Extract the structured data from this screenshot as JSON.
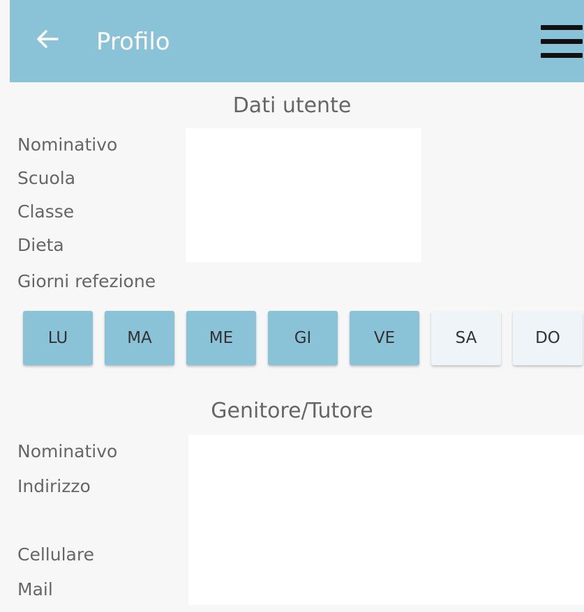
{
  "header": {
    "title": "Profilo",
    "back_icon": "arrow-left-icon",
    "menu_icon": "hamburger-menu-icon",
    "background": "#8ac3d8"
  },
  "user_data": {
    "section_title": "Dati utente",
    "labels": {
      "nominativo": "Nominativo",
      "scuola": "Scuola",
      "classe": "Classe",
      "dieta": "Dieta",
      "giorni": "Giorni refezione"
    }
  },
  "days": [
    {
      "label": "LU",
      "selected": true
    },
    {
      "label": "MA",
      "selected": true
    },
    {
      "label": "ME",
      "selected": true
    },
    {
      "label": "GI",
      "selected": true
    },
    {
      "label": "VE",
      "selected": true
    },
    {
      "label": "SA",
      "selected": false
    },
    {
      "label": "DO",
      "selected": false
    }
  ],
  "guardian": {
    "section_title": "Genitore/Tutore",
    "labels": {
      "nominativo": "Nominativo",
      "indirizzo": "Indirizzo",
      "cellulare": "Cellulare",
      "mail": "Mail"
    }
  }
}
